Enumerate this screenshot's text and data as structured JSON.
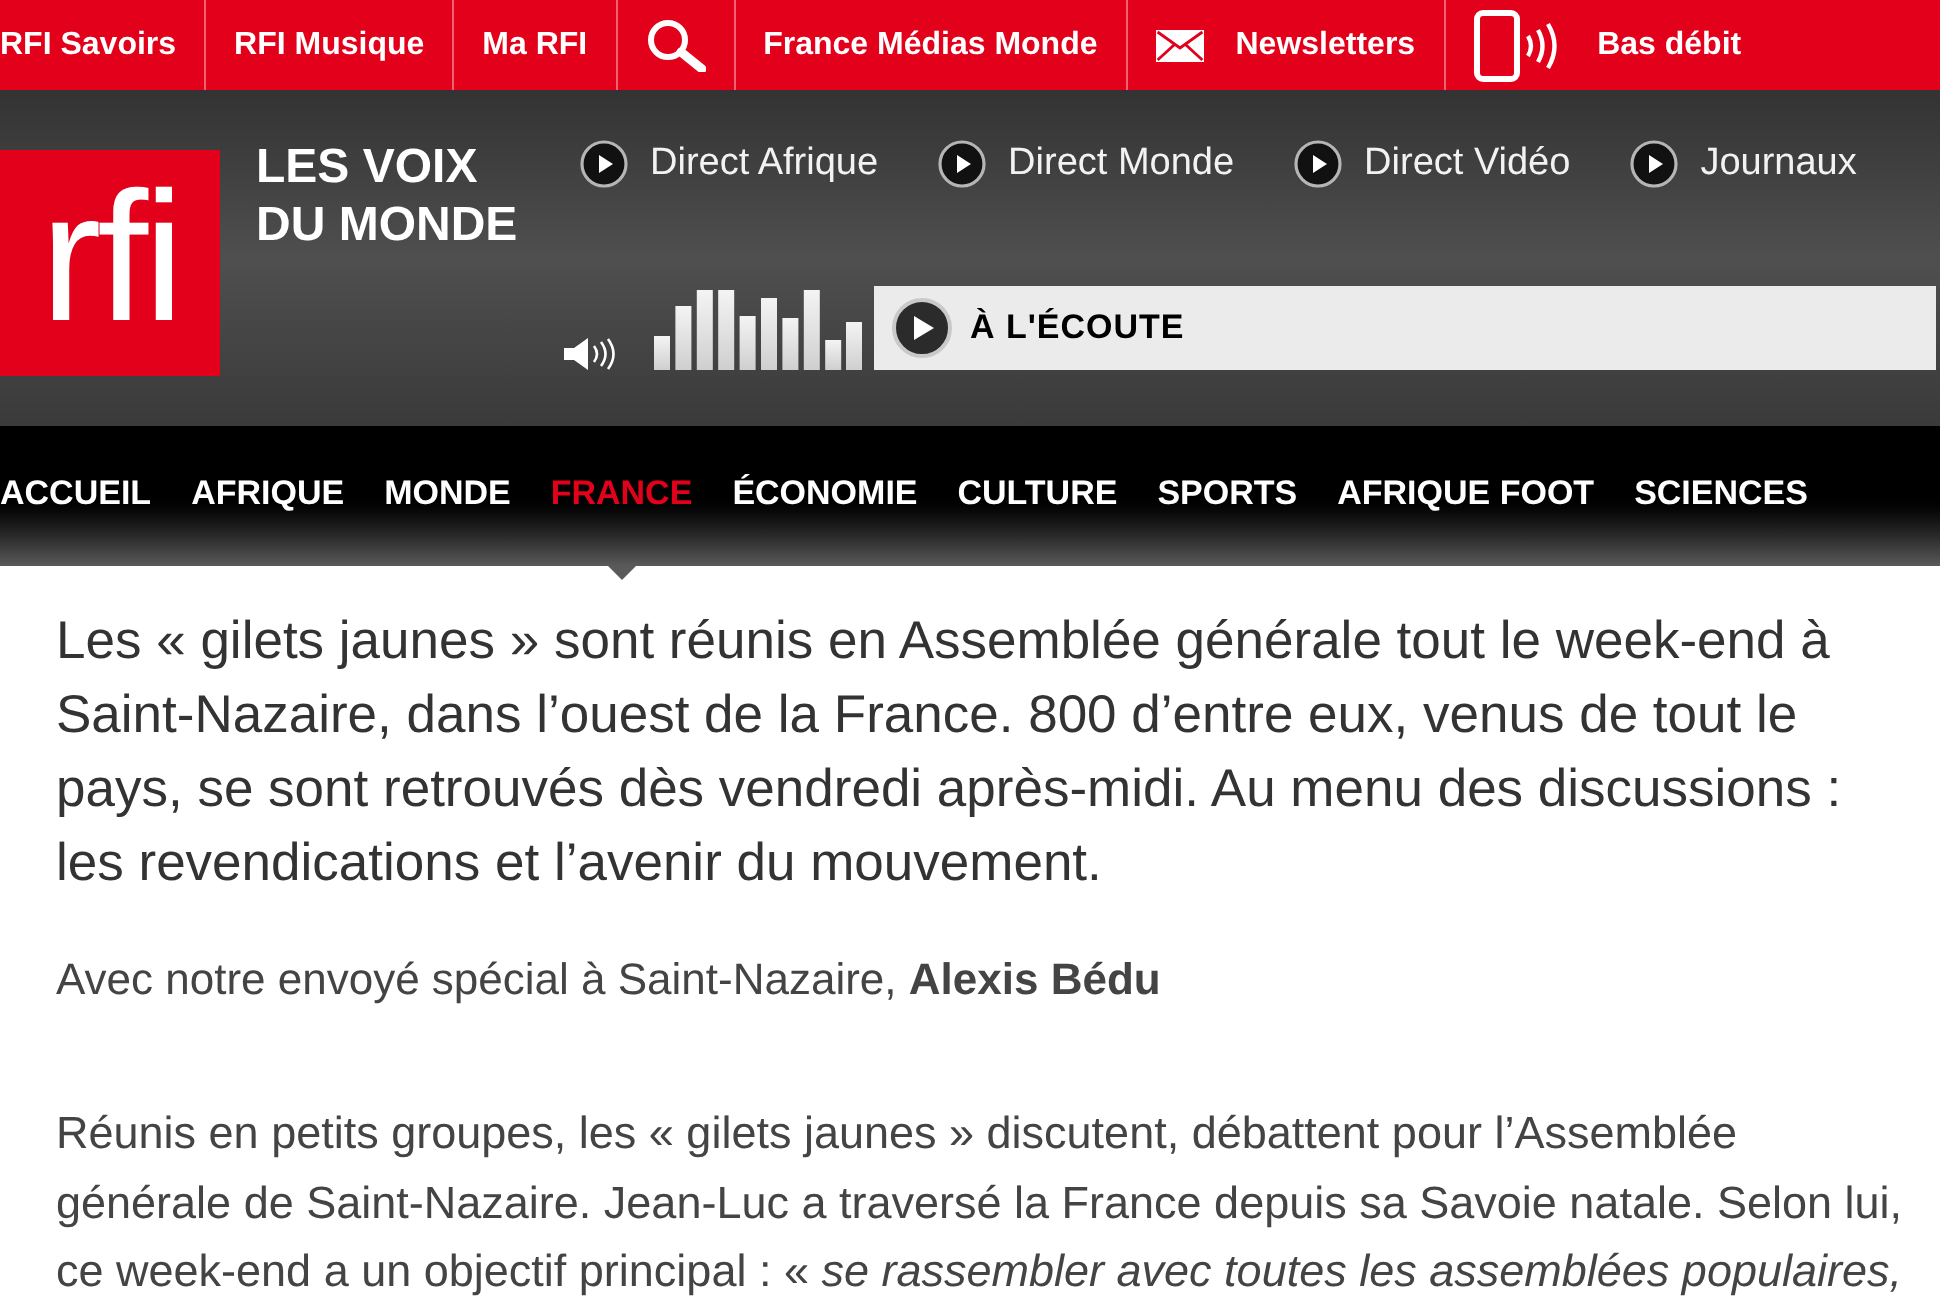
{
  "top_bar": {
    "items": [
      {
        "kind": "link",
        "label": "RFI Savoirs"
      },
      {
        "kind": "link",
        "label": "RFI Musique"
      },
      {
        "kind": "link",
        "label": "Ma RFI"
      },
      {
        "kind": "search"
      },
      {
        "kind": "link",
        "label": "France Médias Monde"
      },
      {
        "kind": "newsletter",
        "label": "Newsletters"
      },
      {
        "kind": "low_bandwidth",
        "label": "Bas débit"
      }
    ]
  },
  "header": {
    "logo": "rfi",
    "tagline": "LES VOIX DU MONDE",
    "live_links": [
      "Direct Afrique",
      "Direct Monde",
      "Direct Vidéo",
      "Journaux"
    ],
    "player": {
      "label": "À L'ÉCOUTE"
    }
  },
  "nav": {
    "items": [
      {
        "label": "ACCUEIL",
        "selected": false
      },
      {
        "label": "AFRIQUE",
        "selected": false
      },
      {
        "label": "MONDE",
        "selected": false
      },
      {
        "label": "FRANCE",
        "selected": true
      },
      {
        "label": "ÉCONOMIE",
        "selected": false
      },
      {
        "label": "CULTURE",
        "selected": false
      },
      {
        "label": "SPORTS",
        "selected": false
      },
      {
        "label": "AFRIQUE FOOT",
        "selected": false
      },
      {
        "label": "SCIENCES",
        "selected": false
      }
    ]
  },
  "article": {
    "lead": "Les « gilets jaunes » sont réunis en Assemblée générale tout le week-end à Saint-Nazaire, dans l’ouest de la France. 800 d’entre eux, venus de tout le pays, se sont retrouvés dès vendredi après-midi. Au menu des discussions : les revendications et l’avenir du mouvement.",
    "byline": "Avec notre envoyé spécial à Saint-Nazaire, **Alexis Bédu**",
    "paragraphs": [
      "Réunis en petits groupes, les « gilets jaunes » discutent, débattent pour l’Assemblée générale de Saint-Nazaire. Jean-Luc a traversé la France depuis sa Savoie natale. Selon lui, ce week-end a un objectif principal : « *se rassembler avec toutes les assemblées populaires,*"
    ]
  }
}
